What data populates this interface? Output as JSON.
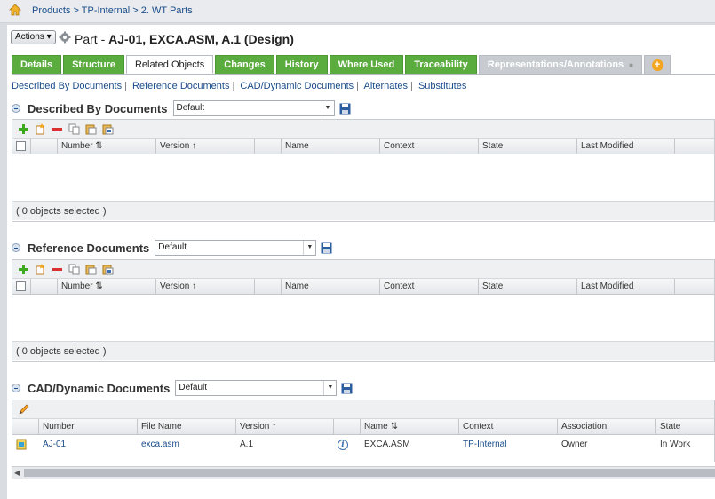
{
  "breadcrumb": {
    "items": [
      "Products",
      "TP-Internal",
      "2. WT Parts"
    ],
    "separator": ">"
  },
  "header": {
    "actions_label": "Actions",
    "title_prefix": "Part - ",
    "title_main": "AJ-01, EXCA.ASM, A.1 (Design)"
  },
  "tabs": [
    {
      "label": "Details",
      "state": "green"
    },
    {
      "label": "Structure",
      "state": "green"
    },
    {
      "label": "Related Objects",
      "state": "active"
    },
    {
      "label": "Changes",
      "state": "green"
    },
    {
      "label": "History",
      "state": "green"
    },
    {
      "label": "Where Used",
      "state": "green"
    },
    {
      "label": "Traceability",
      "state": "green"
    },
    {
      "label": "Representations/Annotations",
      "state": "gray"
    }
  ],
  "sublinks": [
    "Described By Documents",
    "Reference Documents",
    "CAD/Dynamic Documents",
    "Alternates",
    "Substitutes"
  ],
  "sections": [
    {
      "title": "Described By Documents",
      "view": "Default",
      "columns": [
        "Number",
        "Version",
        "Name",
        "Context",
        "State",
        "Last Modified"
      ],
      "footer": "( 0 objects selected )"
    },
    {
      "title": "Reference Documents",
      "view": "Default",
      "columns": [
        "Number",
        "Version",
        "Name",
        "Context",
        "State",
        "Last Modified"
      ],
      "footer": "( 0 objects selected )"
    },
    {
      "title": "CAD/Dynamic Documents",
      "view": "Default",
      "columns": [
        "Number",
        "File Name",
        "Version",
        "Name",
        "Context",
        "Association",
        "State"
      ],
      "rows": [
        {
          "number": "AJ-01",
          "file_name": "exca.asm",
          "version": "A.1",
          "info": "i",
          "name": "EXCA.ASM",
          "context": "TP-Internal",
          "association": "Owner",
          "state": "In Work"
        }
      ]
    }
  ],
  "colors": {
    "tab_green": "#5aac3e",
    "link_blue": "#1a4c8a",
    "add_plus": "#3ea91f",
    "remove_minus": "#d93030"
  }
}
